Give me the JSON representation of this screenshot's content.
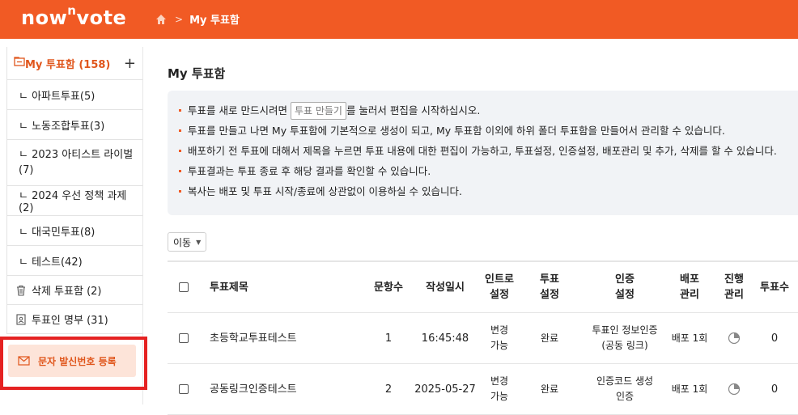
{
  "header": {
    "logo_pre": "now",
    "logo_sup": "n",
    "logo_post": "vote",
    "breadcrumb_current": "My 투표함"
  },
  "sidebar": {
    "title": "My 투표함 (158)",
    "folders": [
      {
        "label": "ㄴ 아파트투표(5)"
      },
      {
        "label": "ㄴ 노동조합투표(3)"
      },
      {
        "label": "ㄴ 2023 아티스트 라이벌 (7)"
      },
      {
        "label": "ㄴ 2024 우선 정책 과제(2)"
      },
      {
        "label": "ㄴ 대국민투표(8)"
      },
      {
        "label": "ㄴ 테스트(42)"
      }
    ],
    "trash": "삭제 투표함 (2)",
    "voters": "투표인 명부 (31)",
    "sms": "문자 발신번호 등록"
  },
  "main": {
    "title": "My 투표함",
    "info": {
      "line1_pre": "투표를 새로 만드시려면",
      "line1_btn": "투표 만들기",
      "line1_post": "를 눌러서 편집을 시작하십시오.",
      "line2": "투표를 만들고 나면 My 투표함에 기본적으로 생성이 되고, My 투표함 이외에 하위 폴더 투표함을 만들어서 관리할 수 있습니다.",
      "line3": "배포하기 전 투표에 대해서 제목을 누르면 투표 내용에 대한 편집이 가능하고, 투표설정, 인증설정, 배포관리 및 추가, 삭제를 할 수 있습니다.",
      "line4": "투표결과는 투표 종료 후 해당 결과를 확인할 수 있습니다.",
      "line5": "복사는 배포 및 투표 시작/종료에 상관없이 이용하실 수 있습니다."
    },
    "move_select": "이동",
    "table": {
      "headers": {
        "title": "투표제목",
        "questions": "문항수",
        "created": "작성일시",
        "intro_1": "인트로",
        "intro_2": "설정",
        "vote_1": "투표",
        "vote_2": "설정",
        "auth_1": "인증",
        "auth_2": "설정",
        "dist_1": "배포",
        "dist_2": "관리",
        "prog_1": "진행",
        "prog_2": "관리",
        "count": "투표수"
      },
      "rows": [
        {
          "title": "초등학교투표테스트",
          "questions": "1",
          "created": "16:45:48",
          "intro_1": "변경",
          "intro_2": "가능",
          "vote": "완료",
          "auth_1": "투표인 정보인증",
          "auth_2": "(공동 링크)",
          "dist": "배포 1회",
          "count": "0"
        },
        {
          "title": "공동링크인증테스트",
          "questions": "2",
          "created": "2025-05-27",
          "intro_1": "변경",
          "intro_2": "가능",
          "vote": "완료",
          "auth_1": "인증코드 생성",
          "auth_2": "인증",
          "dist": "배포 1회",
          "count": "0"
        }
      ]
    }
  },
  "colors": {
    "brand": "#f15a24",
    "highlight_border": "#e52222",
    "sms_bg": "#fde4d9",
    "info_bg": "#f1f3f6"
  }
}
